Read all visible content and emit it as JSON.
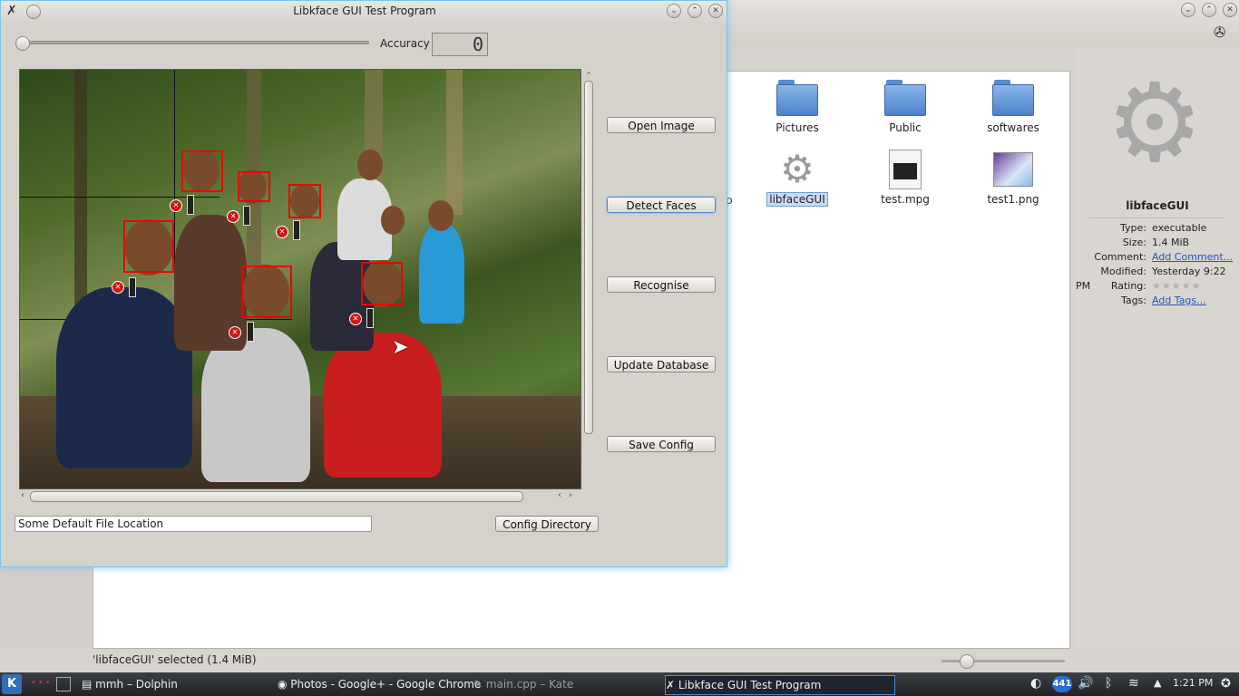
{
  "libface": {
    "title": "Libkface GUI Test Program",
    "accuracy_label": "Accuracy",
    "accuracy_value": "0",
    "accuracy_slider_fraction": 0.0,
    "buttons": {
      "open_image": "Open Image",
      "detect_faces": "Detect Faces",
      "recognise": "Recognise",
      "update_database": "Update Database",
      "save_config": "Save Config",
      "config_directory": "Config Directory"
    },
    "file_location": "Some Default File Location"
  },
  "dolphin": {
    "files": [
      {
        "name": "Pictures",
        "icon": "folder-icon"
      },
      {
        "name": "Public",
        "icon": "folder-icon"
      },
      {
        "name": "softwares",
        "icon": "folder-icon"
      },
      {
        "name": "libfaceGUI",
        "icon": "gear-icon",
        "selected": true
      },
      {
        "name": "test.mpg",
        "icon": "video-file-icon"
      },
      {
        "name": "test1.png",
        "icon": "image-file-icon"
      }
    ],
    "partial_label": "p",
    "info": {
      "name": "libfaceGUI",
      "type_label": "Type:",
      "type": "executable",
      "size_label": "Size:",
      "size": "1.4 MiB",
      "comment_label": "Comment:",
      "comment": "Add Comment...",
      "modified_label": "Modified:",
      "modified": "Yesterday 9:22 PM",
      "rating_label": "Rating:",
      "rating": 0,
      "tags_label": "Tags:",
      "tags": "Add Tags..."
    },
    "status": "'libfaceGUI' selected (1.4 MiB)"
  },
  "taskbar": {
    "tasks": [
      "mmh – Dolphin",
      "Photos - Google+ - Google Chrome",
      "main.cpp – Kate",
      "Libkface GUI Test Program"
    ],
    "battery_text": "441",
    "clock": "1:21 PM"
  },
  "colors": {
    "accent": "#4a8ad0",
    "face_box": "#e00000"
  }
}
